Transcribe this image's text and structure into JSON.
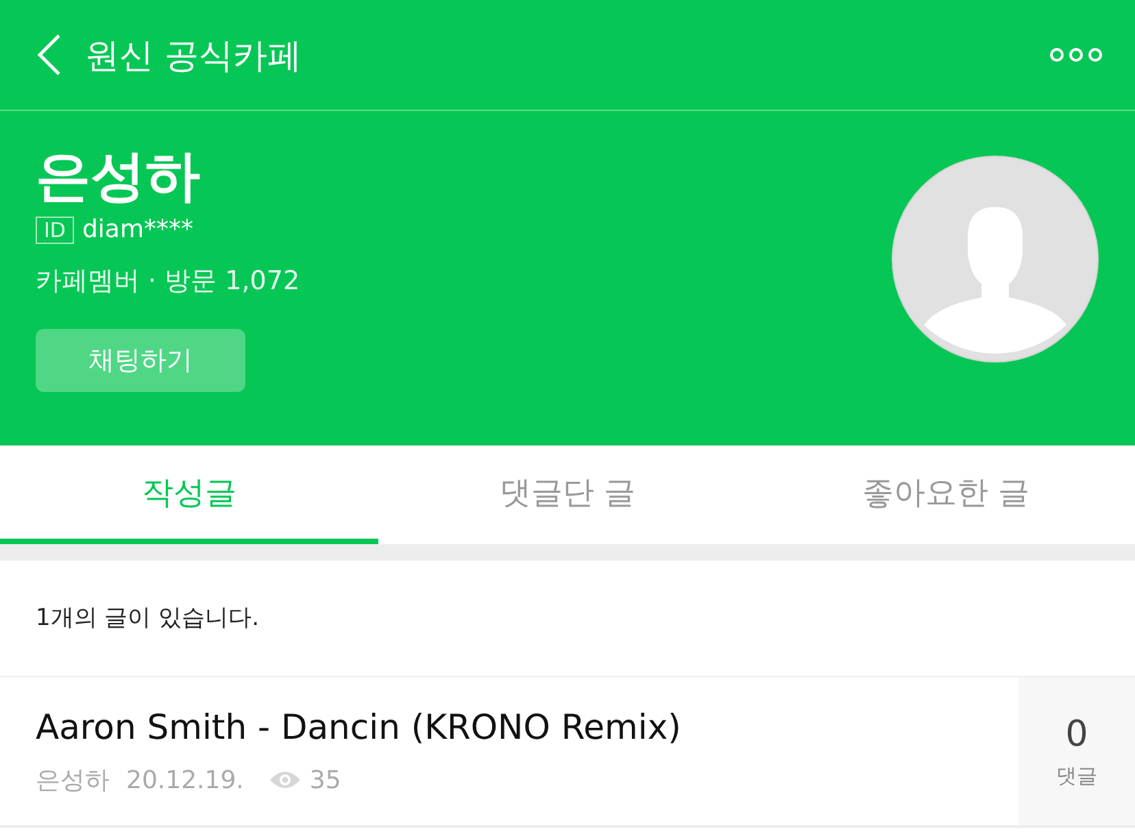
{
  "header": {
    "title": "원신 공식카페"
  },
  "profile": {
    "name": "은성하",
    "id_label": "ID",
    "id": "diam****",
    "meta": "카페멤버 · 방문 1,072",
    "chat_button": "채팅하기"
  },
  "tabs": [
    {
      "label": "작성글",
      "selected": true
    },
    {
      "label": "댓글단 글",
      "selected": false
    },
    {
      "label": "좋아요한 글",
      "selected": false
    }
  ],
  "count_text": "1개의 글이 있습니다.",
  "posts": [
    {
      "title": "Aaron Smith - Dancin (KRONO Remix)",
      "author": "은성하",
      "date": "20.12.19.",
      "views": "35",
      "comments": "0",
      "comments_label": "댓글"
    }
  ]
}
